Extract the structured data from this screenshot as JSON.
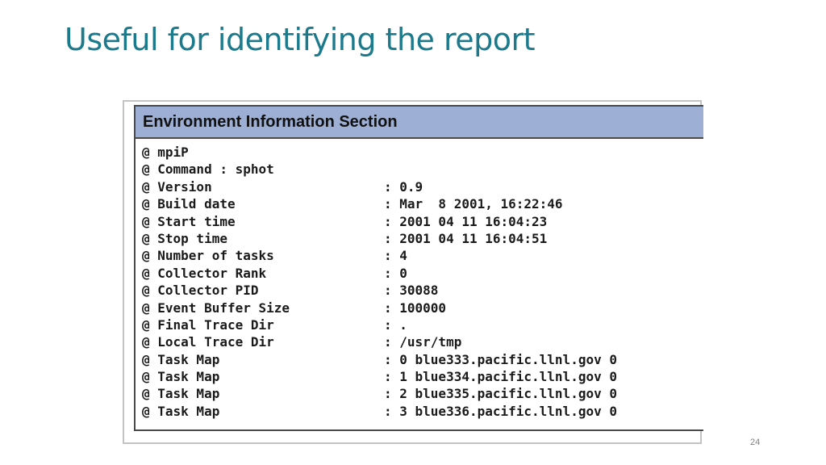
{
  "slide": {
    "title": "Useful for identifying the report",
    "page_number": "24"
  },
  "panel": {
    "header": "Environment Information Section",
    "rows": [
      {
        "label": "@ mpiP",
        "value": ""
      },
      {
        "label": "@ Command : sphot",
        "value": ""
      },
      {
        "label": "@ Version",
        "value": ": 0.9"
      },
      {
        "label": "@ Build date",
        "value": ": Mar  8 2001, 16:22:46"
      },
      {
        "label": "@ Start time",
        "value": ": 2001 04 11 16:04:23"
      },
      {
        "label": "@ Stop time",
        "value": ": 2001 04 11 16:04:51"
      },
      {
        "label": "@ Number of tasks",
        "value": ": 4"
      },
      {
        "label": "@ Collector Rank",
        "value": ": 0"
      },
      {
        "label": "@ Collector PID",
        "value": ": 30088"
      },
      {
        "label": "@ Event Buffer Size",
        "value": ": 100000"
      },
      {
        "label": "@ Final Trace Dir",
        "value": ": ."
      },
      {
        "label": "@ Local Trace Dir",
        "value": ": /usr/tmp"
      },
      {
        "label": "@ Task Map",
        "value": ": 0 blue333.pacific.llnl.gov 0"
      },
      {
        "label": "@ Task Map",
        "value": ": 1 blue334.pacific.llnl.gov 0"
      },
      {
        "label": "@ Task Map",
        "value": ": 2 blue335.pacific.llnl.gov 0"
      },
      {
        "label": "@ Task Map",
        "value": ": 3 blue336.pacific.llnl.gov 0"
      }
    ]
  }
}
